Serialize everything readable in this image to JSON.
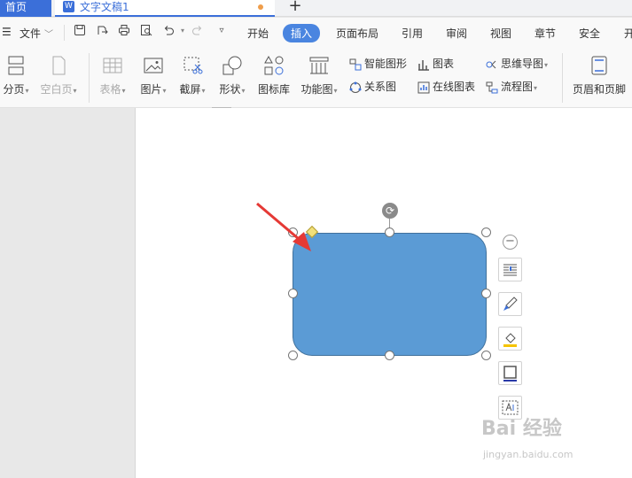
{
  "tabs": {
    "home": "首页",
    "doc_icon": "W",
    "doc_title": "文字文稿1",
    "new_tab": "+"
  },
  "menu": {
    "hamburger": "☰",
    "file": "文件",
    "tabs": [
      "开始",
      "插入",
      "页面布局",
      "引用",
      "审阅",
      "视图",
      "章节",
      "安全",
      "开"
    ],
    "active_tab": "插入"
  },
  "ribbon": {
    "big": {
      "page_break": "分页",
      "blank_page": "空白页",
      "table": "表格",
      "picture": "图片",
      "screenshot": "截屏",
      "shape": "形状",
      "icon_lib": "图标库",
      "func_chart": "功能图",
      "header_footer": "页眉和页脚"
    },
    "small": {
      "smart_art": "智能图形",
      "chart": "图表",
      "mind_map": "思维导图",
      "relation": "关系图",
      "online_chart": "在线图表",
      "flowchart": "流程图"
    }
  },
  "watermark": {
    "main": "Bai 经验",
    "sub": "jingyan.baidu.com"
  },
  "colors": {
    "shape_fill": "#5b9bd5",
    "accent": "#3b6fd9",
    "arrow": "#e53935"
  }
}
